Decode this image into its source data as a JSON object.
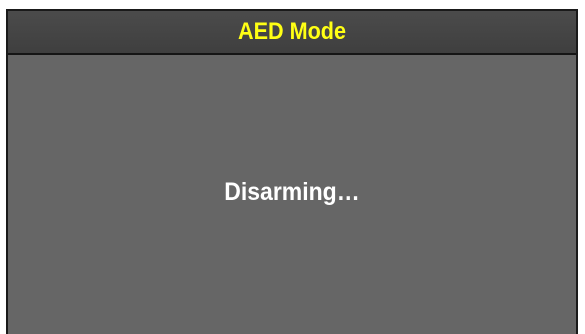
{
  "header": {
    "title": "AED Mode"
  },
  "main": {
    "status": "Disarming…"
  },
  "colors": {
    "title_text": "#ffff14",
    "title_bar": "#434343",
    "background": "#666666",
    "status_text": "#ffffff"
  }
}
